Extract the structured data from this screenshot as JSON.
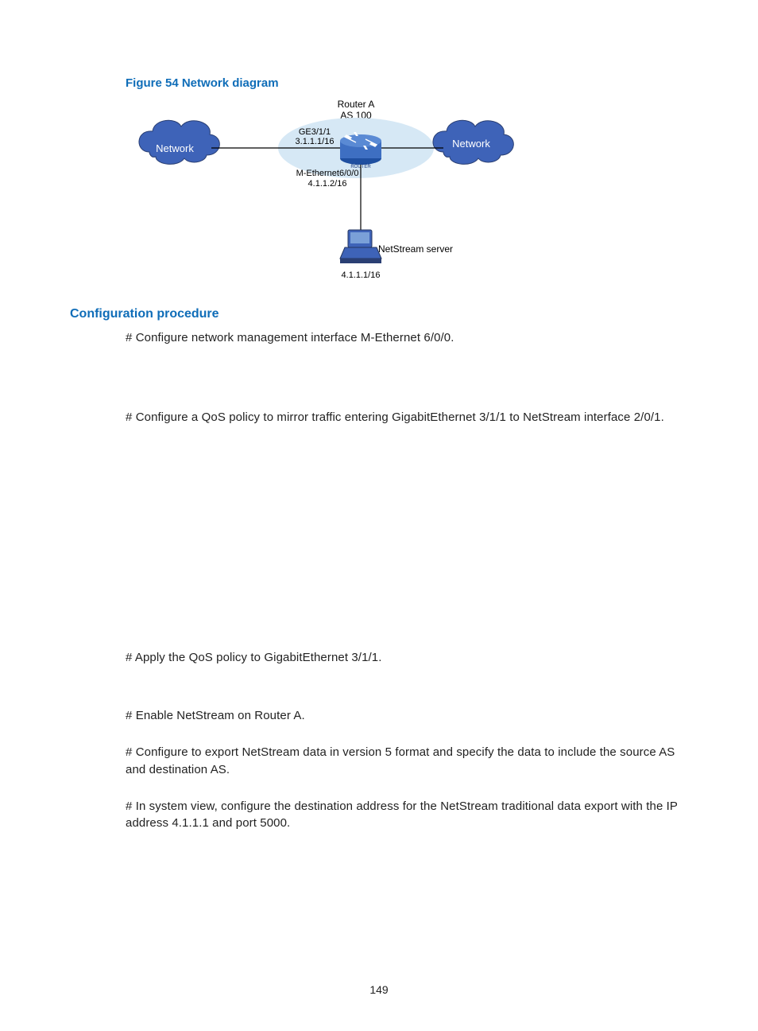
{
  "figure": {
    "caption": "Figure 54 Network diagram",
    "router_name": "Router A",
    "router_as": "AS 100",
    "router_label_small": "ROUTER",
    "left_cloud": "Network",
    "right_cloud": "Network",
    "if_top_line1": "GE3/1/1",
    "if_top_line2": "3.1.1.1/16",
    "if_mid_line1": "M-Ethernet6/0/0",
    "if_mid_line2": "4.1.1.2/16",
    "server_label": "NetStream server",
    "server_ip": "4.1.1.1/16"
  },
  "section": {
    "heading": "Configuration procedure",
    "p1": "# Configure network management interface M-Ethernet 6/0/0.",
    "p2": "# Configure a QoS policy to mirror traffic entering GigabitEthernet 3/1/1 to NetStream interface 2/0/1.",
    "p3": "# Apply the QoS policy to GigabitEthernet 3/1/1.",
    "p4": "# Enable NetStream on Router A.",
    "p5": "# Configure to export NetStream data in version 5 format and specify the data to include the source AS and destination AS.",
    "p6": "# In system view, configure the destination address for the NetStream traditional data export with the IP address 4.1.1.1 and port 5000."
  },
  "page_number": "149"
}
